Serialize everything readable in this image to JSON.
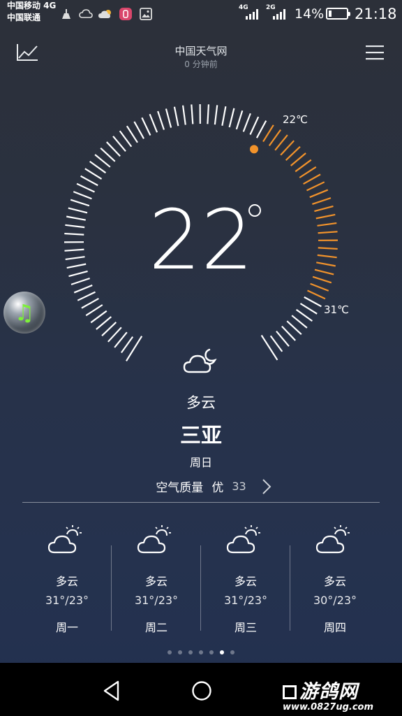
{
  "status_bar": {
    "carrier1": "中国移动 4G",
    "carrier2": "中国联通",
    "net1": "4G",
    "net2": "2G",
    "battery": "14%",
    "time": "21:18"
  },
  "header": {
    "source": "中国天气网",
    "updated": "0 分钟前"
  },
  "current": {
    "temp": "22",
    "low_label": "22℃",
    "high_label": "31℃",
    "condition": "多云",
    "city": "三亚",
    "weekday": "周日",
    "aqi_label": "空气质量",
    "aqi_level": "优",
    "aqi_value": "33"
  },
  "forecast": [
    {
      "condition": "多云",
      "temps": "31°/23°",
      "day": "周一"
    },
    {
      "condition": "多云",
      "temps": "31°/23°",
      "day": "周二"
    },
    {
      "condition": "多云",
      "temps": "31°/23°",
      "day": "周三"
    },
    {
      "condition": "多云",
      "temps": "30°/23°",
      "day": "周四"
    }
  ],
  "pager": {
    "count": 7,
    "active": 5
  },
  "watermark": {
    "main": "游鸽网",
    "url": "www.0827ug.com"
  },
  "icons": {
    "chart": "trend-chart-icon",
    "menu": "hamburger-menu-icon",
    "condition": "cloud-moon-icon",
    "forecast": "cloud-sun-icon",
    "music": "music-note-icon"
  },
  "colors": {
    "accent_orange": "#f2932b",
    "tick_white": "#ffffff"
  }
}
